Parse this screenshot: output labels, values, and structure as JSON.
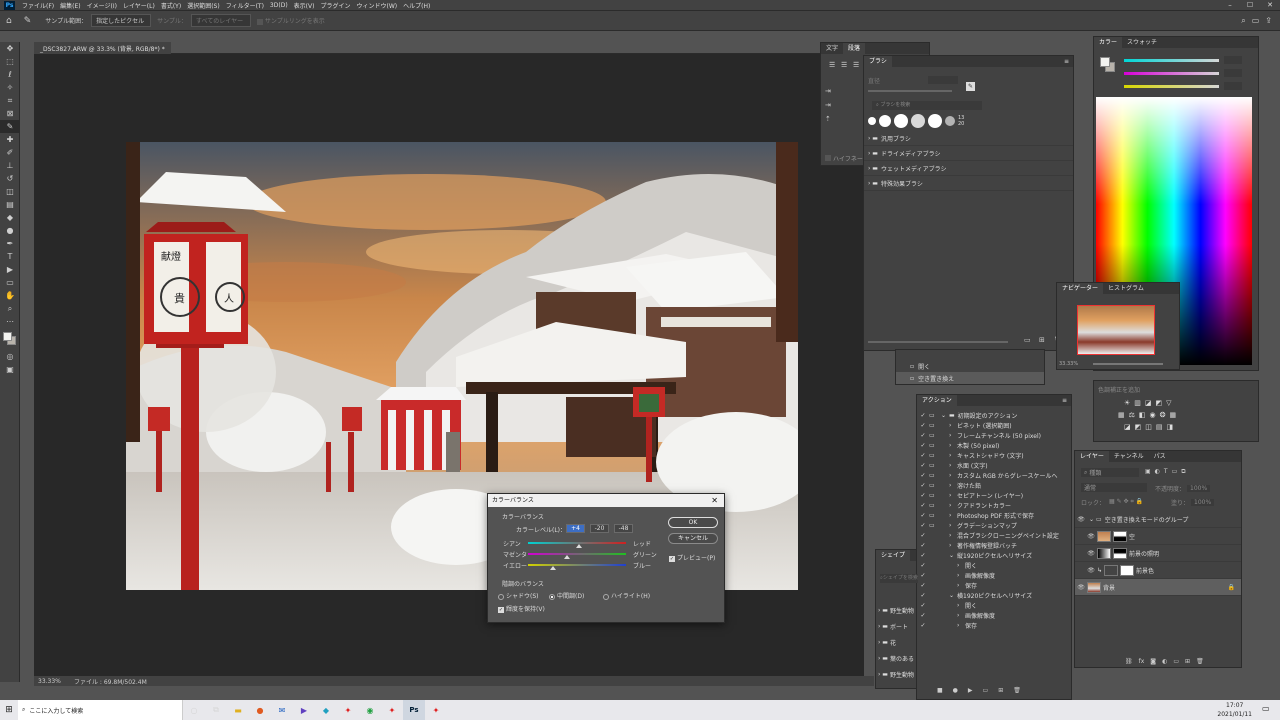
{
  "app": {
    "menu": [
      "ファイル(F)",
      "編集(E)",
      "イメージ(I)",
      "レイヤー(L)",
      "書式(Y)",
      "選択範囲(S)",
      "フィルター(T)",
      "3D(D)",
      "表示(V)",
      "プラグイン",
      "ウィンドウ(W)",
      "ヘルプ(H)"
    ],
    "logo": "Ps"
  },
  "options": {
    "sample_size_label": "サンプル範囲：",
    "sample_size_value": "指定したピクセル",
    "sample_label": "サンプル：",
    "sample_value": "すべてのレイヤー",
    "show_ring": "サンプルリングを表示"
  },
  "document": {
    "tab_title": "_DSC3827.ARW @ 33.3% (背景, RGB/8*) *",
    "zoom": "33.33%",
    "file_info": "ファイル : 69.8M/502.4M"
  },
  "photo": {
    "lantern_text_top": "献燈",
    "lantern_text_mid": "貴",
    "lantern_text_bottom": "人"
  },
  "dialog": {
    "title": "カラーバランス",
    "section_balance": "カラーバランス",
    "color_levels_label": "カラーレベル(L)：",
    "level1": "+4",
    "level2": "-20",
    "level3": "-48",
    "cyan": "シアン",
    "red": "レッド",
    "magenta": "マゼンタ",
    "green": "グリーン",
    "yellow": "イエロー",
    "blue": "ブルー",
    "cyan_red_pos": 0.52,
    "magenta_green_pos": 0.4,
    "yellow_blue_pos": 0.26,
    "tone_section": "階調のバランス",
    "shadows": "シャドウ(S)",
    "midtones": "中間調(D)",
    "highlights": "ハイライト(H)",
    "preserve": "輝度を保持(V)",
    "ok": "OK",
    "cancel": "キャンセル",
    "preview": "プレビュー(P)"
  },
  "char_panel": {
    "tabs": [
      "文字",
      "段落"
    ]
  },
  "char_panel_items": {
    "hyphen": "ハイフネーション"
  },
  "brush_panel": {
    "title": "ブラシ",
    "size_label": "直径",
    "search_placeholder": "ブラシを検索",
    "size_badge_1": "13",
    "size_badge_2": "20",
    "groups": [
      "汎用ブラシ",
      "ドライメディアブラシ",
      "ウェットメディアブラシ",
      "特殊効果ブラシ"
    ]
  },
  "color_panel": {
    "tabs": [
      "カラー",
      "スウォッチ"
    ],
    "fg": "#f3f3f0",
    "bg": "#b8b3ab"
  },
  "navigator": {
    "tabs": [
      "ナビゲーター",
      "ヒストグラム"
    ],
    "zoom": "33.33%"
  },
  "history_panel": {
    "items": [
      "開く",
      "空き置き換え"
    ]
  },
  "actions_panel": {
    "title": "アクション",
    "items": [
      {
        "label": "初期設定のアクション",
        "level": 0
      },
      {
        "label": "ビネット (選択範囲)",
        "level": 1
      },
      {
        "label": "フレームチャンネル (50 pixel)",
        "level": 1
      },
      {
        "label": "木製 (50 pixel)",
        "level": 1
      },
      {
        "label": "キャストシャドウ (文字)",
        "level": 1
      },
      {
        "label": "水面 (文字)",
        "level": 1
      },
      {
        "label": "カスタム RGB からグレースケールへ",
        "level": 1
      },
      {
        "label": "溶けた鉛",
        "level": 1
      },
      {
        "label": "セピアトーン (レイヤー)",
        "level": 1
      },
      {
        "label": "クアドラントカラー",
        "level": 1
      },
      {
        "label": "Photoshop PDF 形式で保存",
        "level": 1
      },
      {
        "label": "グラデーションマップ",
        "level": 1
      },
      {
        "label": "混合ブラシクローニングペイント設定",
        "level": 1
      },
      {
        "label": "著作権情報登録バッチ",
        "level": 1
      },
      {
        "label": "縦1920ピクセルへリサイズ",
        "level": 1
      },
      {
        "label": "開く",
        "level": 2
      },
      {
        "label": "画像解像度",
        "level": 2
      },
      {
        "label": "保存",
        "level": 2
      },
      {
        "label": "横1920ピクセルへリサイズ",
        "level": 1
      },
      {
        "label": "開く",
        "level": 2
      },
      {
        "label": "画像解像度",
        "level": 2
      },
      {
        "label": "保存",
        "level": 2
      }
    ]
  },
  "adjust_panel": {
    "title": "色調補正を追加"
  },
  "shapes_panel": {
    "title": "シェイプ",
    "search_placeholder": "シェイプを検索",
    "items": [
      "野生動物",
      "ボート",
      "花",
      "葉のある",
      "野生動物"
    ]
  },
  "layers_panel": {
    "tabs": [
      "レイヤー",
      "チャンネル",
      "パス"
    ],
    "search_placeholder": "種類",
    "blend_mode": "通常",
    "opacity_label": "不透明度：",
    "opacity_value": "100%",
    "lock_label": "ロック：",
    "fill_label": "塗り：",
    "fill_value": "100%",
    "layers": [
      {
        "name": "空き置き換えモードのグループ",
        "type": "group"
      },
      {
        "name": "空",
        "type": "mask"
      },
      {
        "name": "前景の照明",
        "type": "mask"
      },
      {
        "name": "前景色",
        "type": "adjust"
      },
      {
        "name": "背景",
        "type": "bg"
      }
    ]
  },
  "taskbar": {
    "search_placeholder": "ここに入力して検索",
    "time": "17:07",
    "date": "2021/01/11"
  }
}
